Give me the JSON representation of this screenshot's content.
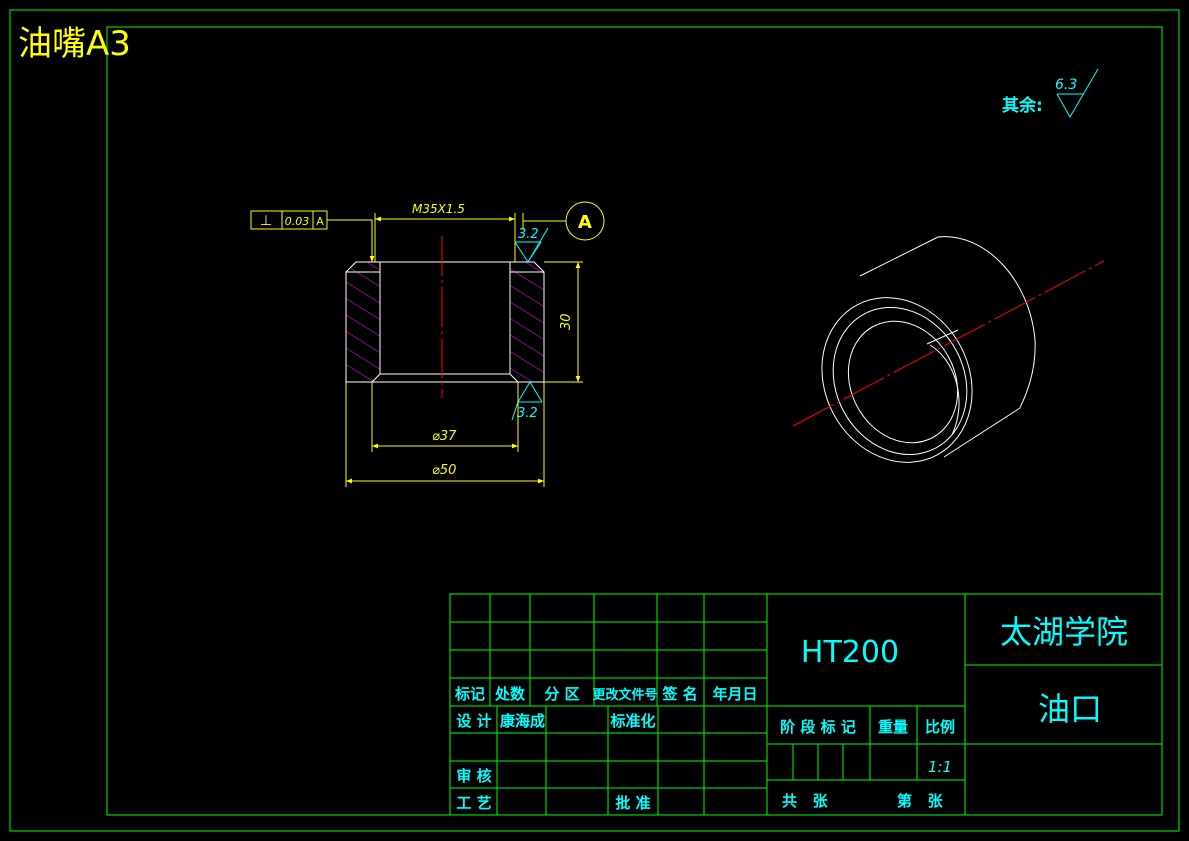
{
  "sheet": {
    "title": "油嘴A3"
  },
  "roughness": {
    "other_label": "其余:",
    "other_value": "6.3",
    "top_value": "3.2",
    "bottom_value": "3.2"
  },
  "tolerance": {
    "symbol": "⊥",
    "value": "0.03",
    "datum": "A"
  },
  "datum_label": "A",
  "dimensions": {
    "thread": "M35X1.5",
    "height": "30",
    "inner_diameter": "⌀37",
    "outer_diameter": "⌀50"
  },
  "title_block": {
    "material": "HT200",
    "school": "太湖学院",
    "part_name": "油口",
    "headers": [
      "标记",
      "处数",
      "分 区",
      "更改文件号",
      "签 名",
      "年月日"
    ],
    "design_label": "设 计",
    "designer": "康海成",
    "standardization_label": "标准化",
    "review_label": "审 核",
    "process_label": "工 艺",
    "approve_label": "批 准",
    "stage_mark_label": "阶 段 标 记",
    "weight_label": "重量",
    "scale_label": "比例",
    "scale_value": "1:1",
    "total_sheets_label": "共   张",
    "sheet_no_label": "第   张"
  },
  "colors": {
    "background": "#000000",
    "frame": "#00ff00",
    "text_cyan": "#00ffff",
    "dimension_yellow": "#ffff00",
    "hatch_magenta": "#ff00ff",
    "centerline_red": "#ff0000",
    "outline_white": "#ffffff",
    "title_yellow": "#ffff00"
  }
}
